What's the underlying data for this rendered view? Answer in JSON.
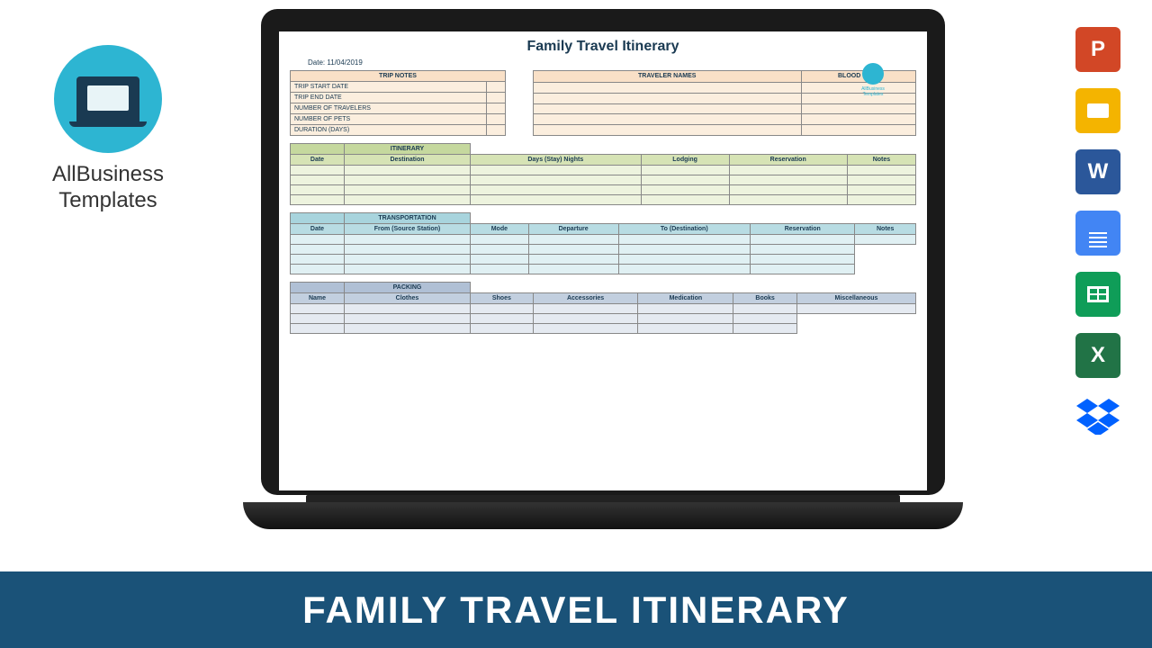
{
  "logo": {
    "line1": "AllBusiness",
    "line2": "Templates"
  },
  "document": {
    "title": "Family Travel Itinerary",
    "date_label": "Date:",
    "date_value": "11/04/2019",
    "small_logo_text": "AllBusiness Templates",
    "trip_notes": {
      "header": "TRIP NOTES",
      "rows": [
        "TRIP START DATE",
        "TRIP END DATE",
        "NUMBER OF TRAVELERS",
        "NUMBER OF PETS",
        "DURATION (DAYS)"
      ]
    },
    "traveler": {
      "col1": "TRAVELER NAMES",
      "col2": "BLOOD TYPE"
    },
    "itinerary": {
      "title": "ITINERARY",
      "cols": [
        "Date",
        "Destination",
        "Days (Stay) Nights",
        "Lodging",
        "Reservation",
        "Notes"
      ]
    },
    "transportation": {
      "title": "TRANSPORTATION",
      "cols": [
        "Date",
        "From (Source Station)",
        "Mode",
        "Departure",
        "To (Destination)",
        "Reservation",
        "Notes"
      ]
    },
    "packing": {
      "title": "PACKING",
      "cols": [
        "Name",
        "Clothes",
        "Shoes",
        "Accessories",
        "Medication",
        "Books",
        "Miscellaneous"
      ]
    }
  },
  "banner": "FAMILY TRAVEL ITINERARY",
  "icons": {
    "powerpoint": "P",
    "slides": "",
    "word": "W",
    "docs": "",
    "sheets": "",
    "excel": "X",
    "dropbox": ""
  }
}
